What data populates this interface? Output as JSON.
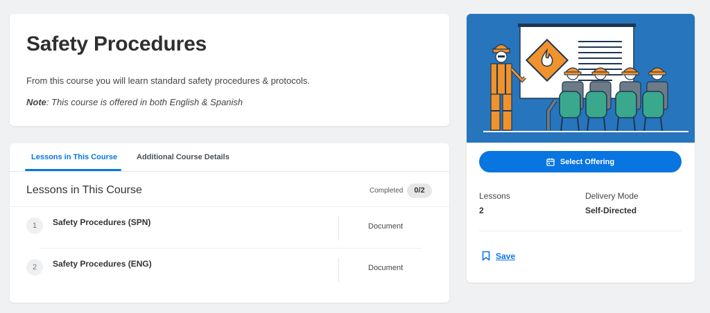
{
  "course": {
    "title": "Safety Procedures",
    "description": "From this course you will learn standard safety procedures & protocols.",
    "note_label": "Note",
    "note_text": ": This course is offered in both English & Spanish"
  },
  "tabs": [
    {
      "label": "Lessons in This Course",
      "active": true
    },
    {
      "label": "Additional Course Details",
      "active": false
    }
  ],
  "lessons_section": {
    "heading": "Lessons in This Course",
    "completed_label": "Completed",
    "completed_value": "0/2"
  },
  "lessons": [
    {
      "number": "1",
      "name": "Safety Procedures (SPN)",
      "type": "Document"
    },
    {
      "number": "2",
      "name": "Safety Procedures (ENG)",
      "type": "Document"
    }
  ],
  "side": {
    "select_label": "Select Offering",
    "lessons_label": "Lessons",
    "lessons_value": "2",
    "delivery_label": "Delivery Mode",
    "delivery_value": "Self-Directed",
    "save_label": "Save"
  },
  "icons": {
    "select": "calendar-icon",
    "save": "bookmark-icon",
    "illustration_sign": "fire-hazard-icon"
  },
  "colors": {
    "accent": "#0875e1",
    "illustration_bg": "#2775bd",
    "hazard_orange": "#f0922d",
    "chair_green": "#3aa88c"
  }
}
